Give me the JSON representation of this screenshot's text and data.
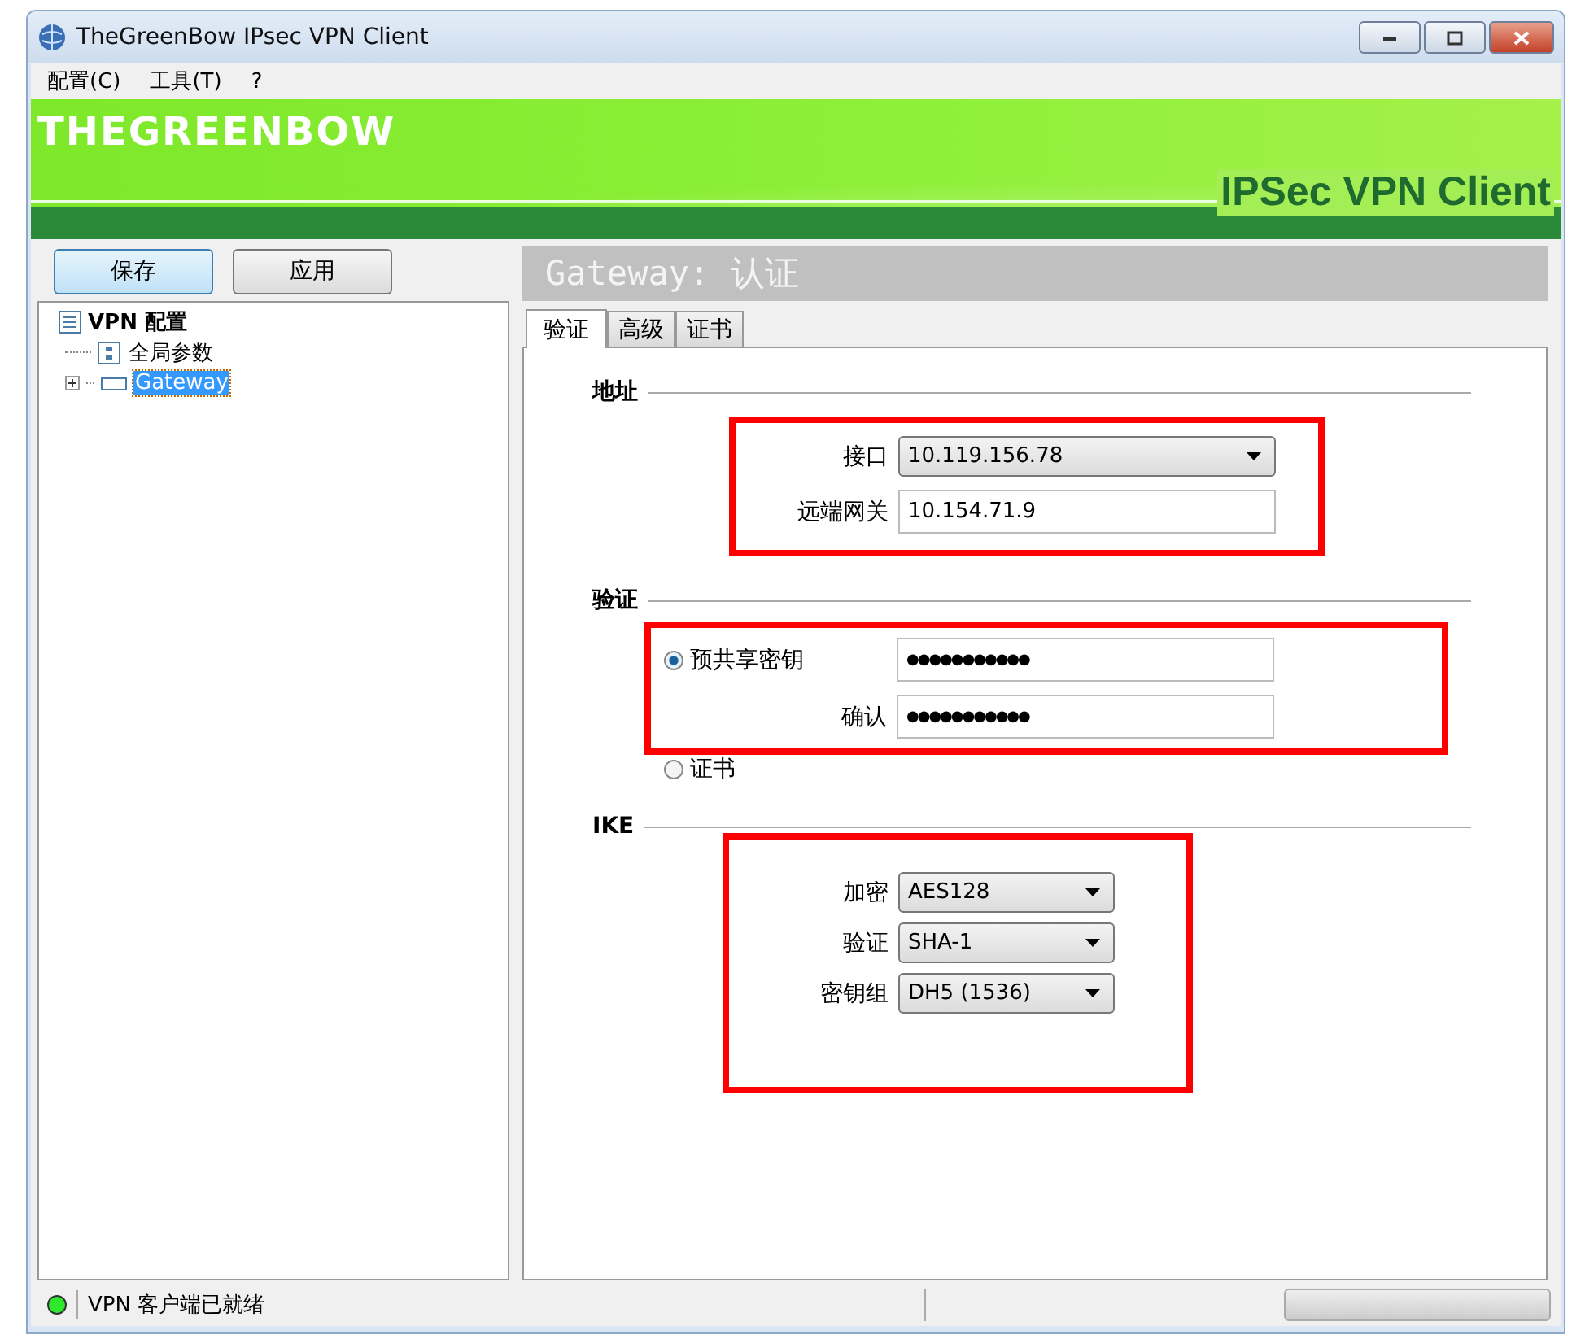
{
  "window": {
    "title": "TheGreenBow IPsec VPN Client"
  },
  "menu": [
    "配置(C)",
    "工具(T)",
    "?"
  ],
  "banner": {
    "logo": "THEGREENBOW",
    "product": "IPSec VPN Client"
  },
  "buttons": [
    {
      "label": "保存",
      "selected": true
    },
    {
      "label": "应用",
      "selected": false
    }
  ],
  "tree": {
    "label": "VPN 配置",
    "children": [
      {
        "label": "全局参数",
        "kind": "settings",
        "selected": false
      },
      {
        "label": "Gateway",
        "kind": "gateway",
        "selected": true,
        "expanded": false
      }
    ]
  },
  "panel_title": "Gateway: 认证",
  "tabs": [
    {
      "label": "验证",
      "selected": true
    },
    {
      "label": "高级",
      "selected": false
    },
    {
      "label": "证书",
      "selected": false
    }
  ],
  "sections": [
    {
      "title": "地址",
      "highlighted": true,
      "rows": [
        {
          "kind": "dropdown",
          "label": "接口",
          "value": "10.119.156.78"
        },
        {
          "kind": "text",
          "label": "远端网关",
          "value": "10.154.71.9"
        }
      ]
    },
    {
      "title": "验证",
      "highlighted": true,
      "rows": [
        {
          "kind": "radio",
          "label": "预共享密钥",
          "selected": true,
          "value": "●●●●●●●●●●●"
        },
        {
          "kind": "text",
          "label": "确认",
          "value": "●●●●●●●●●●●"
        }
      ],
      "extra_rows": [
        {
          "kind": "radio",
          "label": "证书",
          "selected": false
        }
      ]
    },
    {
      "title": "IKE",
      "highlighted": true,
      "rows": [
        {
          "kind": "dropdown",
          "label": "加密",
          "value": "AES128"
        },
        {
          "kind": "dropdown",
          "label": "验证",
          "value": "SHA-1"
        },
        {
          "kind": "dropdown",
          "label": "密钥组",
          "value": "DH5 (1536)"
        }
      ]
    }
  ],
  "status_bar": {
    "online": true,
    "text": "VPN 客户端已就绪"
  }
}
